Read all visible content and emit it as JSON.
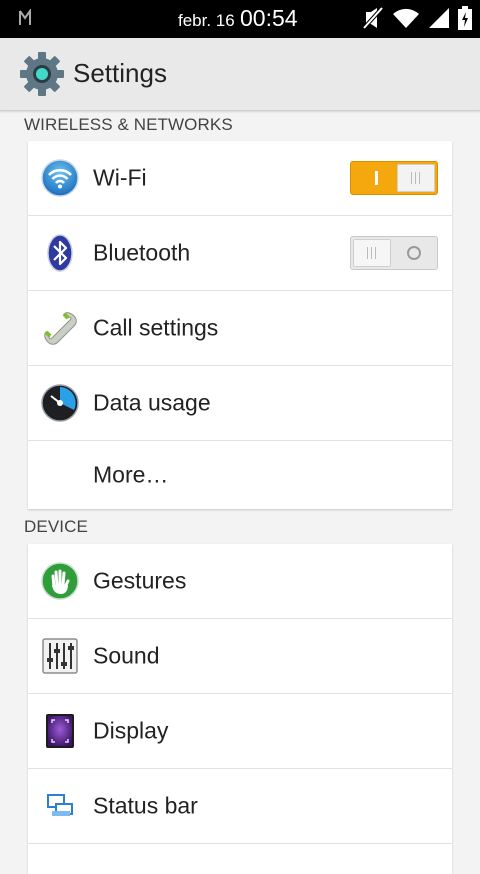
{
  "status_bar": {
    "date": "febr. 16",
    "time": "00:54"
  },
  "action_bar": {
    "title": "Settings"
  },
  "sections": {
    "wireless": {
      "header": "WIRELESS & NETWORKS",
      "items": [
        {
          "label": "Wi-Fi",
          "icon": "wifi-icon",
          "toggle": "on"
        },
        {
          "label": "Bluetooth",
          "icon": "bluetooth-icon",
          "toggle": "off"
        },
        {
          "label": "Call settings",
          "icon": "phone-icon"
        },
        {
          "label": "Data usage",
          "icon": "data-usage-icon"
        },
        {
          "label": "More…"
        }
      ]
    },
    "device": {
      "header": "DEVICE",
      "items": [
        {
          "label": "Gestures",
          "icon": "gestures-icon"
        },
        {
          "label": "Sound",
          "icon": "sound-icon"
        },
        {
          "label": "Display",
          "icon": "display-icon"
        },
        {
          "label": "Status bar",
          "icon": "status-bar-icon"
        }
      ]
    }
  },
  "colors": {
    "accent": "#f5a80d",
    "background": "#f3f3f3"
  }
}
